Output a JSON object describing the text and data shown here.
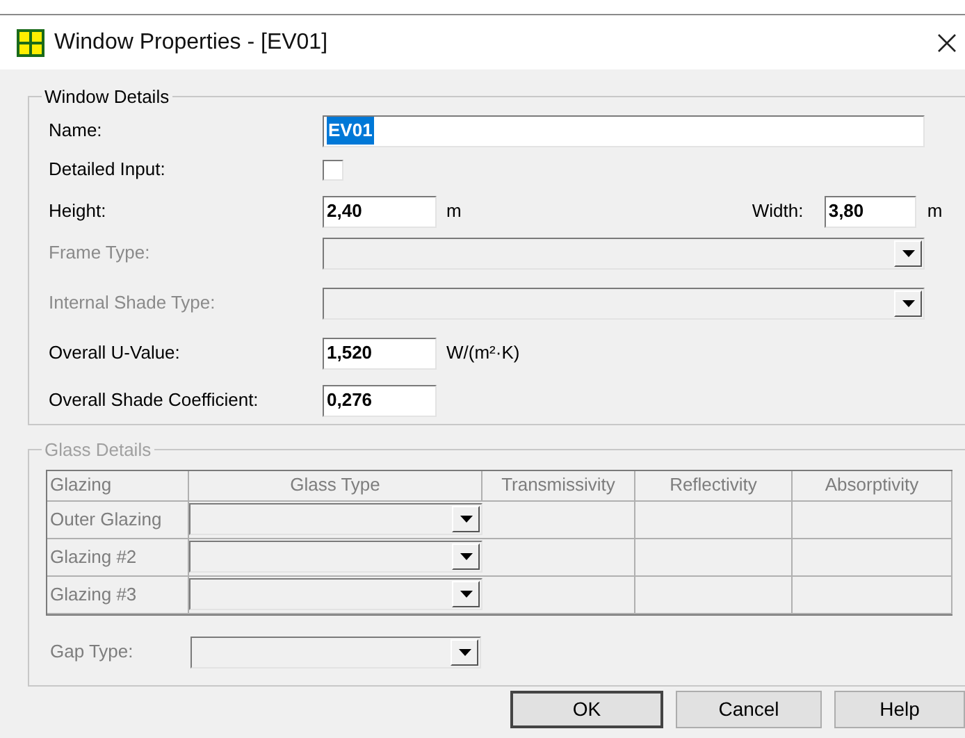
{
  "window": {
    "title": "Window Properties - [EV01]"
  },
  "window_details": {
    "legend": "Window Details",
    "name": {
      "label": "Name:",
      "value": "EV01",
      "selected": true
    },
    "detailed_input": {
      "label": "Detailed Input:",
      "checked": false
    },
    "height": {
      "label": "Height:",
      "value": "2,40",
      "unit": "m"
    },
    "width": {
      "label": "Width:",
      "value": "3,80",
      "unit": "m"
    },
    "frame_type": {
      "label": "Frame Type:",
      "disabled": true
    },
    "internal_shade_type": {
      "label": "Internal Shade Type:",
      "disabled": true
    },
    "u_value": {
      "label": "Overall U-Value:",
      "value": "1,520",
      "unit": "W/(m²·K)"
    },
    "shade_coefficient": {
      "label": "Overall Shade Coefficient:",
      "value": "0,276"
    }
  },
  "glass_details": {
    "legend": "Glass Details",
    "disabled": true,
    "columns": [
      "Glazing",
      "Glass Type",
      "Transmissivity",
      "Reflectivity",
      "Absorptivity"
    ],
    "rows": [
      {
        "label": "Outer Glazing"
      },
      {
        "label": "Glazing #2"
      },
      {
        "label": "Glazing #3"
      }
    ],
    "gap_type": {
      "label": "Gap Type:"
    }
  },
  "buttons": [
    {
      "label": "OK",
      "default": true
    },
    {
      "label": "Cancel",
      "default": false
    },
    {
      "label": "Help",
      "default": false
    }
  ]
}
